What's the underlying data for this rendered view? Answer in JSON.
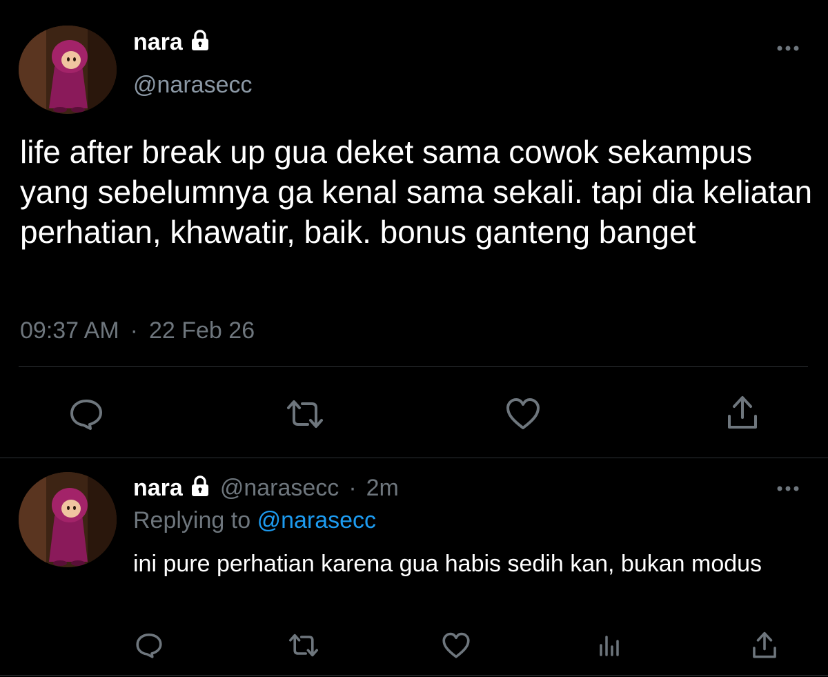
{
  "colors": {
    "background": "#000000",
    "text_primary": "#ffffff",
    "text_secondary": "#6e767d",
    "handle": "#8b98a5",
    "link": "#1d9bf0",
    "divider": "#2f3336"
  },
  "main_tweet": {
    "display_name": "nara",
    "handle": "@narasecc",
    "text": "life after break up gua deket sama cowok sekampus yang sebelumnya ga kenal sama sekali. tapi dia keliatan perhatian, khawatir, baik. bonus ganteng banget",
    "time": "09:37 AM",
    "separator": "·",
    "date": "22 Feb 26",
    "actions": [
      "reply-icon",
      "retweet-icon",
      "like-icon",
      "share-icon"
    ]
  },
  "reply_tweet": {
    "display_name": "nara",
    "handle": "@narasecc",
    "separator": "·",
    "age": "2m",
    "replying_prefix": "Replying to",
    "replying_to": "@narasecc",
    "text": "ini pure perhatian karena gua habis sedih kan, bukan modus",
    "actions": [
      "reply-icon",
      "retweet-icon",
      "like-icon",
      "analytics-icon",
      "share-icon"
    ]
  }
}
